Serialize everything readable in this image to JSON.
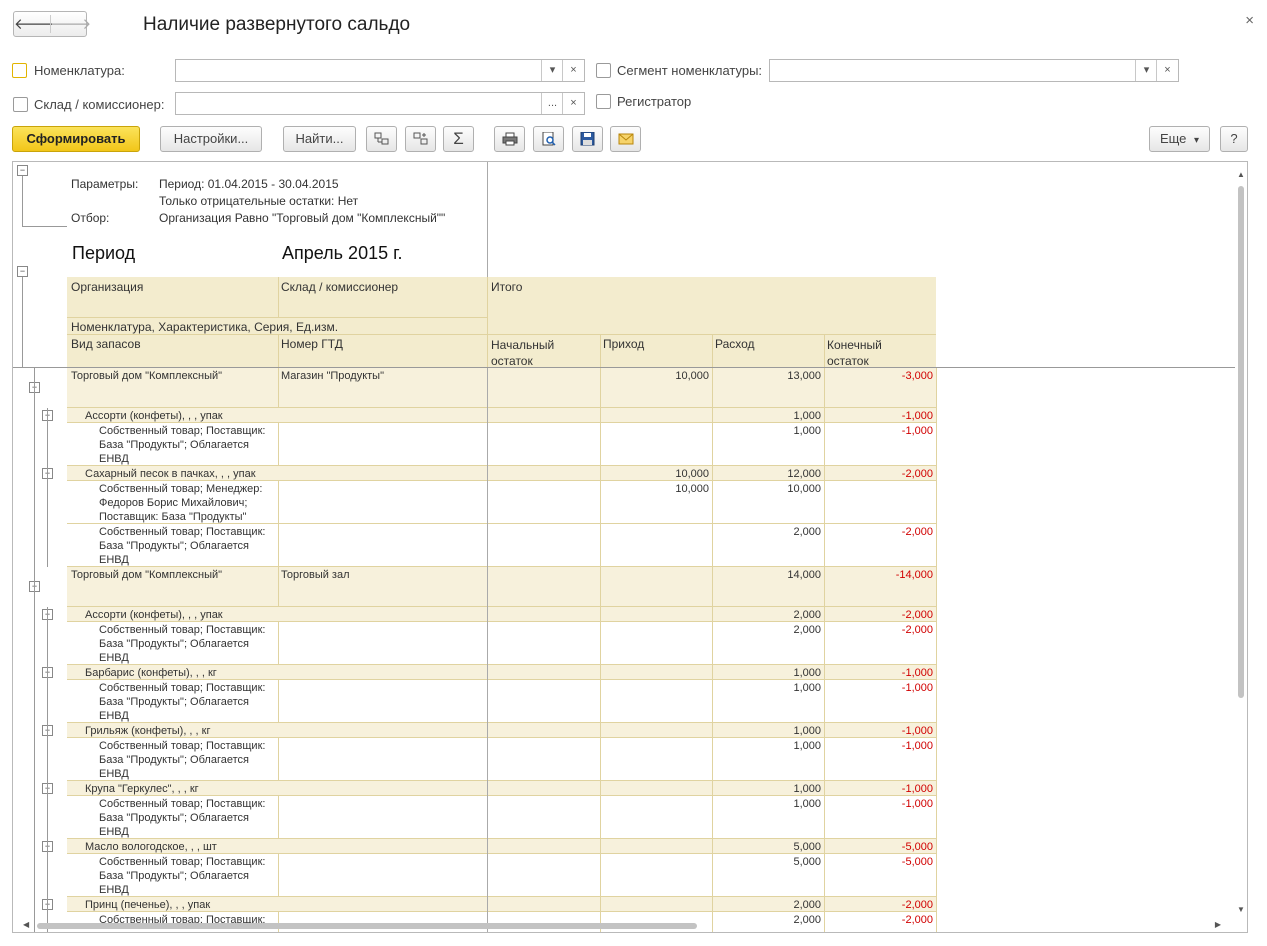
{
  "window": {
    "title": "Наличие развернутого сальдо",
    "back": "🡐",
    "forward": "🡒",
    "close": "×"
  },
  "filters": {
    "nomenclature_label": "Номенклатура:",
    "warehouse_label": "Склад / комиссионер:",
    "segment_label": "Сегмент номенклатуры:",
    "registrar_label": "Регистратор",
    "dropdown_glyph": "▾",
    "clear_glyph": "×",
    "select_glyph": "..."
  },
  "toolbar": {
    "generate": "Сформировать",
    "settings": "Настройки...",
    "find": "Найти...",
    "sum": "Σ",
    "more": "Еще",
    "more_arrow": "▾",
    "help": "?",
    "icons": [
      "expand-groups-icon",
      "collapse-groups-icon",
      "sum-icon",
      "print-icon",
      "preview-icon",
      "save-icon",
      "mail-icon"
    ]
  },
  "report": {
    "params_label": "Параметры:",
    "params_period": "Период: 01.04.2015 - 30.04.2015",
    "params_negative": "Только отрицательные остатки: Нет",
    "filter_label": "Отбор:",
    "filter_value": "Организация Равно \"Торговый дом \"Комплексный\"\"",
    "period_label": "Период",
    "period_value": "Апрель 2015 г.",
    "columns": {
      "org": "Организация",
      "warehouse": "Склад / комиссионер",
      "total": "Итого",
      "nomenclature": "Номенклатура, Характеристика, Серия, Ед.изм.",
      "stock_type": "Вид запасов",
      "gtd": "Номер ГТД",
      "start": "Начальный\nостаток",
      "income": "Приход",
      "expense": "Расход",
      "end": "Конечный\nостаток"
    },
    "rows": [
      {
        "level": 0,
        "a": "Торговый дом \"Комплексный\"",
        "b": "Магазин \"Продукты\"",
        "s": "",
        "i": "10,000",
        "e": "13,000",
        "f": "-3,000"
      },
      {
        "level": 1,
        "a": "Ассорти (конфеты), , , упак",
        "b": "",
        "s": "",
        "i": "",
        "e": "1,000",
        "f": "-1,000"
      },
      {
        "level": 2,
        "a": "Собственный товар; Поставщик:\nБаза \"Продукты\"; Облагается\nЕНВД",
        "b": "",
        "s": "",
        "i": "",
        "e": "1,000",
        "f": "-1,000"
      },
      {
        "level": 1,
        "a": "Сахарный песок в пачках, , , упак",
        "b": "",
        "s": "",
        "i": "10,000",
        "e": "12,000",
        "f": "-2,000"
      },
      {
        "level": 2,
        "a": "Собственный товар; Менеджер:\nФедоров Борис Михайлович;\nПоставщик: База \"Продукты\"",
        "b": "",
        "s": "",
        "i": "10,000",
        "e": "10,000",
        "f": ""
      },
      {
        "level": 2,
        "a": "Собственный товар; Поставщик:\nБаза \"Продукты\"; Облагается\nЕНВД",
        "b": "",
        "s": "",
        "i": "",
        "e": "2,000",
        "f": "-2,000"
      },
      {
        "level": 0,
        "a": "Торговый дом \"Комплексный\"",
        "b": "Торговый зал",
        "s": "",
        "i": "",
        "e": "14,000",
        "f": "-14,000"
      },
      {
        "level": 1,
        "a": "Ассорти (конфеты), , , упак",
        "b": "",
        "s": "",
        "i": "",
        "e": "2,000",
        "f": "-2,000"
      },
      {
        "level": 2,
        "a": "Собственный товар; Поставщик:\nБаза \"Продукты\"; Облагается\nЕНВД",
        "b": "",
        "s": "",
        "i": "",
        "e": "2,000",
        "f": "-2,000"
      },
      {
        "level": 1,
        "a": "Барбарис (конфеты), , , кг",
        "b": "",
        "s": "",
        "i": "",
        "e": "1,000",
        "f": "-1,000"
      },
      {
        "level": 2,
        "a": "Собственный товар; Поставщик:\nБаза \"Продукты\"; Облагается\nЕНВД",
        "b": "",
        "s": "",
        "i": "",
        "e": "1,000",
        "f": "-1,000"
      },
      {
        "level": 1,
        "a": "Грильяж (конфеты), , , кг",
        "b": "",
        "s": "",
        "i": "",
        "e": "1,000",
        "f": "-1,000"
      },
      {
        "level": 2,
        "a": "Собственный товар; Поставщик:\nБаза \"Продукты\"; Облагается\nЕНВД",
        "b": "",
        "s": "",
        "i": "",
        "e": "1,000",
        "f": "-1,000"
      },
      {
        "level": 1,
        "a": "Крупа \"Геркулес\", , , кг",
        "b": "",
        "s": "",
        "i": "",
        "e": "1,000",
        "f": "-1,000"
      },
      {
        "level": 2,
        "a": "Собственный товар; Поставщик:\nБаза \"Продукты\"; Облагается\nЕНВД",
        "b": "",
        "s": "",
        "i": "",
        "e": "1,000",
        "f": "-1,000"
      },
      {
        "level": 1,
        "a": "Масло вологодское, , , шт",
        "b": "",
        "s": "",
        "i": "",
        "e": "5,000",
        "f": "-5,000"
      },
      {
        "level": 2,
        "a": "Собственный товар; Поставщик:\nБаза \"Продукты\"; Облагается\nЕНВД",
        "b": "",
        "s": "",
        "i": "",
        "e": "5,000",
        "f": "-5,000"
      },
      {
        "level": 1,
        "a": "Принц (печенье), , , упак",
        "b": "",
        "s": "",
        "i": "",
        "e": "2,000",
        "f": "-2,000"
      },
      {
        "level": 2,
        "a": "Собственный товар; Поставщик:",
        "b": "",
        "s": "",
        "i": "",
        "e": "2,000",
        "f": "-2,000"
      }
    ]
  }
}
